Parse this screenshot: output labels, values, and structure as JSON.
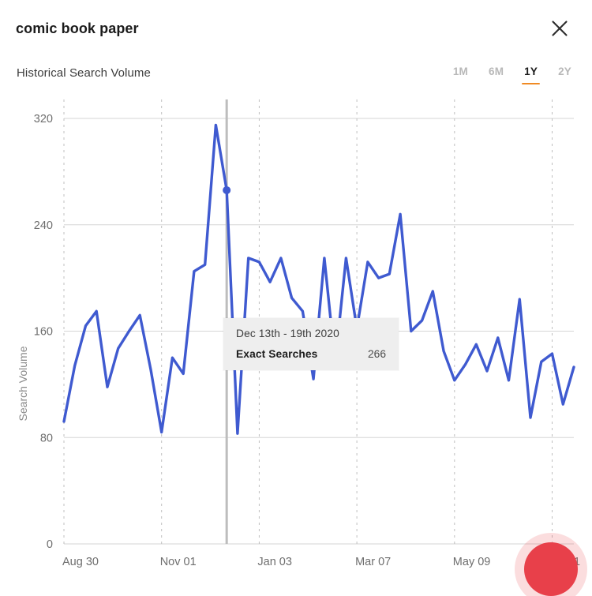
{
  "header": {
    "title": "comic book paper",
    "close_icon": "close-icon"
  },
  "section": {
    "title": "Historical Search Volume",
    "ranges": [
      {
        "label": "1M",
        "active": false
      },
      {
        "label": "6M",
        "active": false
      },
      {
        "label": "1Y",
        "active": true
      },
      {
        "label": "2Y",
        "active": false
      }
    ],
    "active_range": "1Y",
    "accent_color": "#f08a24"
  },
  "tooltip": {
    "date_range": "Dec 13th - 19th 2020",
    "metric_label": "Exact Searches",
    "metric_value": "266"
  },
  "chart_data": {
    "type": "line",
    "title": "Historical Search Volume",
    "xlabel": "",
    "ylabel": "Search Volume",
    "ylim": [
      0,
      320
    ],
    "yticks": [
      0,
      80,
      160,
      240,
      320
    ],
    "ytick_labels": [
      "0",
      "80",
      "160",
      "240",
      "320"
    ],
    "xtick_labels": [
      "Aug 30",
      "Nov 01",
      "Jan 03",
      "Mar 07",
      "May 09",
      "Jul 11"
    ],
    "xtick_indices": [
      0,
      9,
      18,
      27,
      36,
      45
    ],
    "grid": "horizontal-solid-and-vertical-dashed",
    "legend": "none",
    "line_color": "#3f5ad0",
    "highlight": {
      "index": 15,
      "label": "Dec 13th - 19th 2020",
      "value": 266,
      "marker_color": "#3f5ad0",
      "crosshair_color": "#bdbdbd"
    },
    "series": [
      {
        "name": "Exact Searches",
        "values": [
          92,
          134,
          164,
          175,
          118,
          147,
          160,
          172,
          131,
          84,
          140,
          128,
          205,
          210,
          315,
          266,
          83,
          215,
          212,
          197,
          215,
          185,
          175,
          124,
          215,
          136,
          215,
          162,
          212,
          200,
          203,
          248,
          160,
          168,
          190,
          145,
          123,
          135,
          150,
          130,
          155,
          123,
          184,
          95,
          137,
          143,
          105,
          133
        ]
      }
    ]
  }
}
